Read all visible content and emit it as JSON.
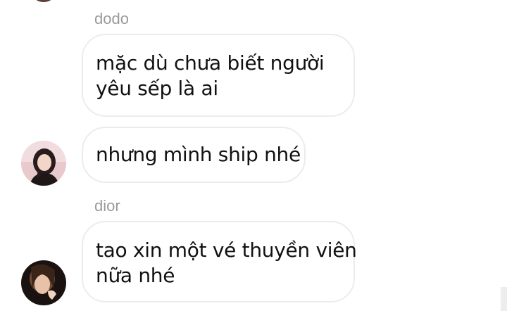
{
  "messages": [
    {
      "sender": "dodo",
      "lines": [
        "mặc dù chưa biết người",
        "yêu sếp là ai"
      ]
    },
    {
      "sender": "",
      "lines": [
        "nhưng mình ship nhé"
      ]
    },
    {
      "sender": "dior",
      "lines": [
        "tao xin một vé thuyền viên",
        "nữa nhé"
      ]
    }
  ],
  "colors": {
    "bubble_border": "#ececec",
    "sender_text": "#9a9a9a",
    "message_text": "#111111"
  }
}
